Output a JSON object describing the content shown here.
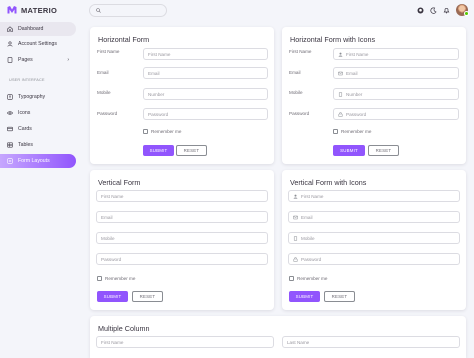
{
  "brand": {
    "name": "MATERIO",
    "color": "#9155fd"
  },
  "sidebar": {
    "items": [
      {
        "label": "Dashboard",
        "icon": "home-icon"
      },
      {
        "label": "Account Settings",
        "icon": "account-icon"
      },
      {
        "label": "Pages",
        "icon": "file-icon"
      }
    ],
    "section_label": "USER INTERFACE",
    "ui_items": [
      {
        "label": "Typography",
        "icon": "typography-icon"
      },
      {
        "label": "Icons",
        "icon": "eye-icon"
      },
      {
        "label": "Cards",
        "icon": "card-icon"
      },
      {
        "label": "Tables",
        "icon": "table-icon"
      },
      {
        "label": "Form Layouts",
        "icon": "form-icon",
        "active": true
      }
    ]
  },
  "topbar": {
    "icons": [
      "github-icon",
      "dark-mode-icon",
      "bell-icon",
      "avatar"
    ]
  },
  "horizontal_form": {
    "title": "Horizontal Form",
    "labels": [
      "First Name",
      "Email",
      "Mobile",
      "Password"
    ],
    "placeholders": [
      "First Name",
      "Email",
      "Number",
      "Password"
    ],
    "remember": "Remember me",
    "submit": "SUBMIT",
    "reset": "RESET"
  },
  "horizontal_icons_form": {
    "title": "Horizontal Form with Icons",
    "labels": [
      "First Name",
      "Email",
      "Mobile",
      "Password"
    ],
    "placeholders": [
      "First Name",
      "Email",
      "Number",
      "Password"
    ],
    "remember": "Remember me",
    "submit": "SUBMIT",
    "reset": "RESET"
  },
  "vertical_form": {
    "title": "Vertical Form",
    "placeholders": [
      "First Name",
      "Email",
      "Mobile",
      "Password"
    ],
    "remember": "Remember me",
    "submit": "SUBMIT",
    "reset": "RESET"
  },
  "vertical_icons_form": {
    "title": "Vertical Form with Icons",
    "placeholders": [
      "First Name",
      "Email",
      "Mobile",
      "Password"
    ],
    "remember": "Remember me",
    "submit": "SUBMIT",
    "reset": "RESET"
  },
  "multiple_column": {
    "title": "Multiple Column",
    "placeholders": [
      "First Name",
      "Last Name"
    ]
  }
}
